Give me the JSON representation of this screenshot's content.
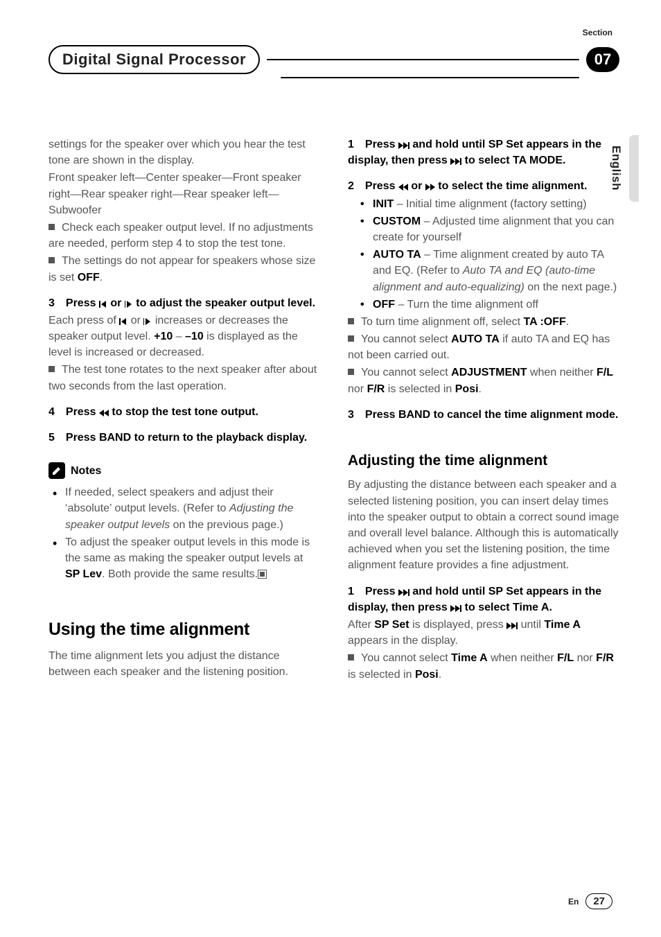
{
  "header": {
    "section_label": "Section",
    "title": "Digital Signal Processor",
    "section_number": "07",
    "language": "English"
  },
  "left": {
    "intro_p1a": "settings for the speaker over which you hear the test tone are shown in the display.",
    "intro_p1b": "Front speaker left—Center speaker—Front speaker right—Rear speaker right—Rear speaker left—Subwoofer",
    "bullet1": "Check each speaker output level. If no adjustments are needed, perform step 4 to stop the test tone.",
    "bullet2_a": "The settings do not appear for speakers whose size is set ",
    "bullet2_off": "OFF",
    "bullet2_b": ".",
    "step3_a": "Press ",
    "step3_b": " or ",
    "step3_c": " to adjust the speaker output level.",
    "step3_body_a": "Each press of ",
    "step3_body_b": " or ",
    "step3_body_c": " increases or decreases the speaker output level. ",
    "step3_plus": "+10",
    "step3_dash": " – ",
    "step3_minus": "–10",
    "step3_body_d": " is displayed as the level is increased or decreased.",
    "step3_bullet": "The test tone rotates to the next speaker after about two seconds from the last operation.",
    "step4_a": "Press ",
    "step4_b": " to stop the test tone output.",
    "step5": "Press BAND to return to the playback display.",
    "notes_label": "Notes",
    "note1_a": "If needed, select speakers and adjust their ‘absolute’ output levels. (Refer to ",
    "note1_italic": "Adjusting the speaker output levels",
    "note1_b": " on the previous page.)",
    "note2_a": "To adjust the speaker output levels in this mode is the same as making the speaker output levels at ",
    "note2_splev": "SP Lev",
    "note2_b": ". Both provide the same results.",
    "h2": "Using the time alignment",
    "h2_body": "The time alignment lets you adjust the distance between each speaker and the listening position."
  },
  "right": {
    "step1_a": "Press ",
    "step1_b": " and hold until SP Set appears in the display, then press ",
    "step1_c": " to select TA MODE.",
    "step2_a": "Press ",
    "step2_b": " or ",
    "step2_c": " to select the time alignment.",
    "opts": {
      "init_label": "INIT",
      "init_text": " – Initial time alignment (factory setting)",
      "custom_label": "CUSTOM",
      "custom_text": " – Adjusted time alignment that you can create for yourself",
      "auto_label": "AUTO TA",
      "auto_text_a": " – Time alignment created by auto TA and EQ. (Refer to ",
      "auto_italic": "Auto TA and EQ (auto-time alignment and auto-equalizing)",
      "auto_text_b": " on the next page.)",
      "off_label": "OFF",
      "off_text": " – Turn the time alignment off"
    },
    "b1_a": "To turn time alignment off, select ",
    "b1_bold": "TA :OFF",
    "b1_b": ".",
    "b2_a": "You cannot select ",
    "b2_bold": "AUTO TA",
    "b2_b": " if auto TA and EQ has not been carried out.",
    "b3_a": "You cannot select ",
    "b3_bold1": "ADJUSTMENT",
    "b3_b": " when neither ",
    "b3_bold2": "F/L",
    "b3_c": " nor ",
    "b3_bold3": "F/R",
    "b3_d": " is selected in ",
    "b3_bold4": "Posi",
    "b3_e": ".",
    "step3": "Press BAND to cancel the time alignment mode.",
    "h3": "Adjusting the time alignment",
    "h3_body": "By adjusting the distance between each speaker and a selected listening position, you can insert delay times into the speaker output to obtain a correct sound image and overall level balance. Although this is automatically achieved when you set the listening position, the time alignment feature provides a fine adjustment.",
    "s1_a": "Press ",
    "s1_b": " and hold until SP Set appears in the display, then press ",
    "s1_c": " to select Time A.",
    "s1_body_a": "After ",
    "s1_bold1": "SP Set",
    "s1_body_b": " is displayed, press ",
    "s1_body_c": " until ",
    "s1_bold2": "Time A",
    "s1_body_d": " appears in the display.",
    "s1_b2_a": "You cannot select ",
    "s1_b2_bold1": "Time A",
    "s1_b2_b": " when neither ",
    "s1_b2_bold2": "F/L",
    "s1_b2_c": " nor ",
    "s1_b2_bold3": "F/R",
    "s1_b2_d": " is selected in ",
    "s1_b2_bold4": "Posi",
    "s1_b2_e": "."
  },
  "footer": {
    "lang": "En",
    "page": "27"
  },
  "nums": {
    "n1": "1",
    "n2": "2",
    "n3": "3",
    "n4": "4",
    "n5": "5"
  }
}
